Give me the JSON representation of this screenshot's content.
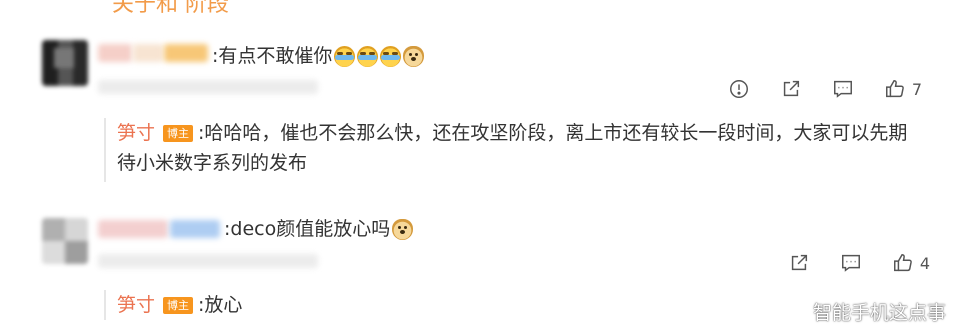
{
  "top_remnant": "关于和 阶段",
  "comments": [
    {
      "text": ":有点不敢催你",
      "emojis": [
        "cry-laugh-emoji",
        "cry-laugh-emoji",
        "cry-laugh-emoji",
        "doge-emoji"
      ],
      "like_count": "7",
      "reply": {
        "author": "笋寸",
        "badge": "博主",
        "text": ":哈哈哈，催也不会那么快，还在攻坚阶段，离上市还有较长一段时间，大家可以先期待小米数字系列的发布",
        "line1": ":哈哈哈，催也不会那么快，还在攻坚阶段，离上市还有较长一段时间，大家可以先期",
        "line2": "待小米数字系列的发布"
      }
    },
    {
      "text": ":deco颜值能放心吗",
      "emojis": [
        "doge-emoji"
      ],
      "like_count": "4",
      "reply": {
        "author": "笋寸",
        "badge": "博主",
        "text": ":放心"
      }
    }
  ],
  "watermark": "智能手机这点事",
  "colors": {
    "reply_name": "#eb7350",
    "badge_bg": "#f7951e",
    "text": "#333333",
    "icon": "#555555"
  }
}
